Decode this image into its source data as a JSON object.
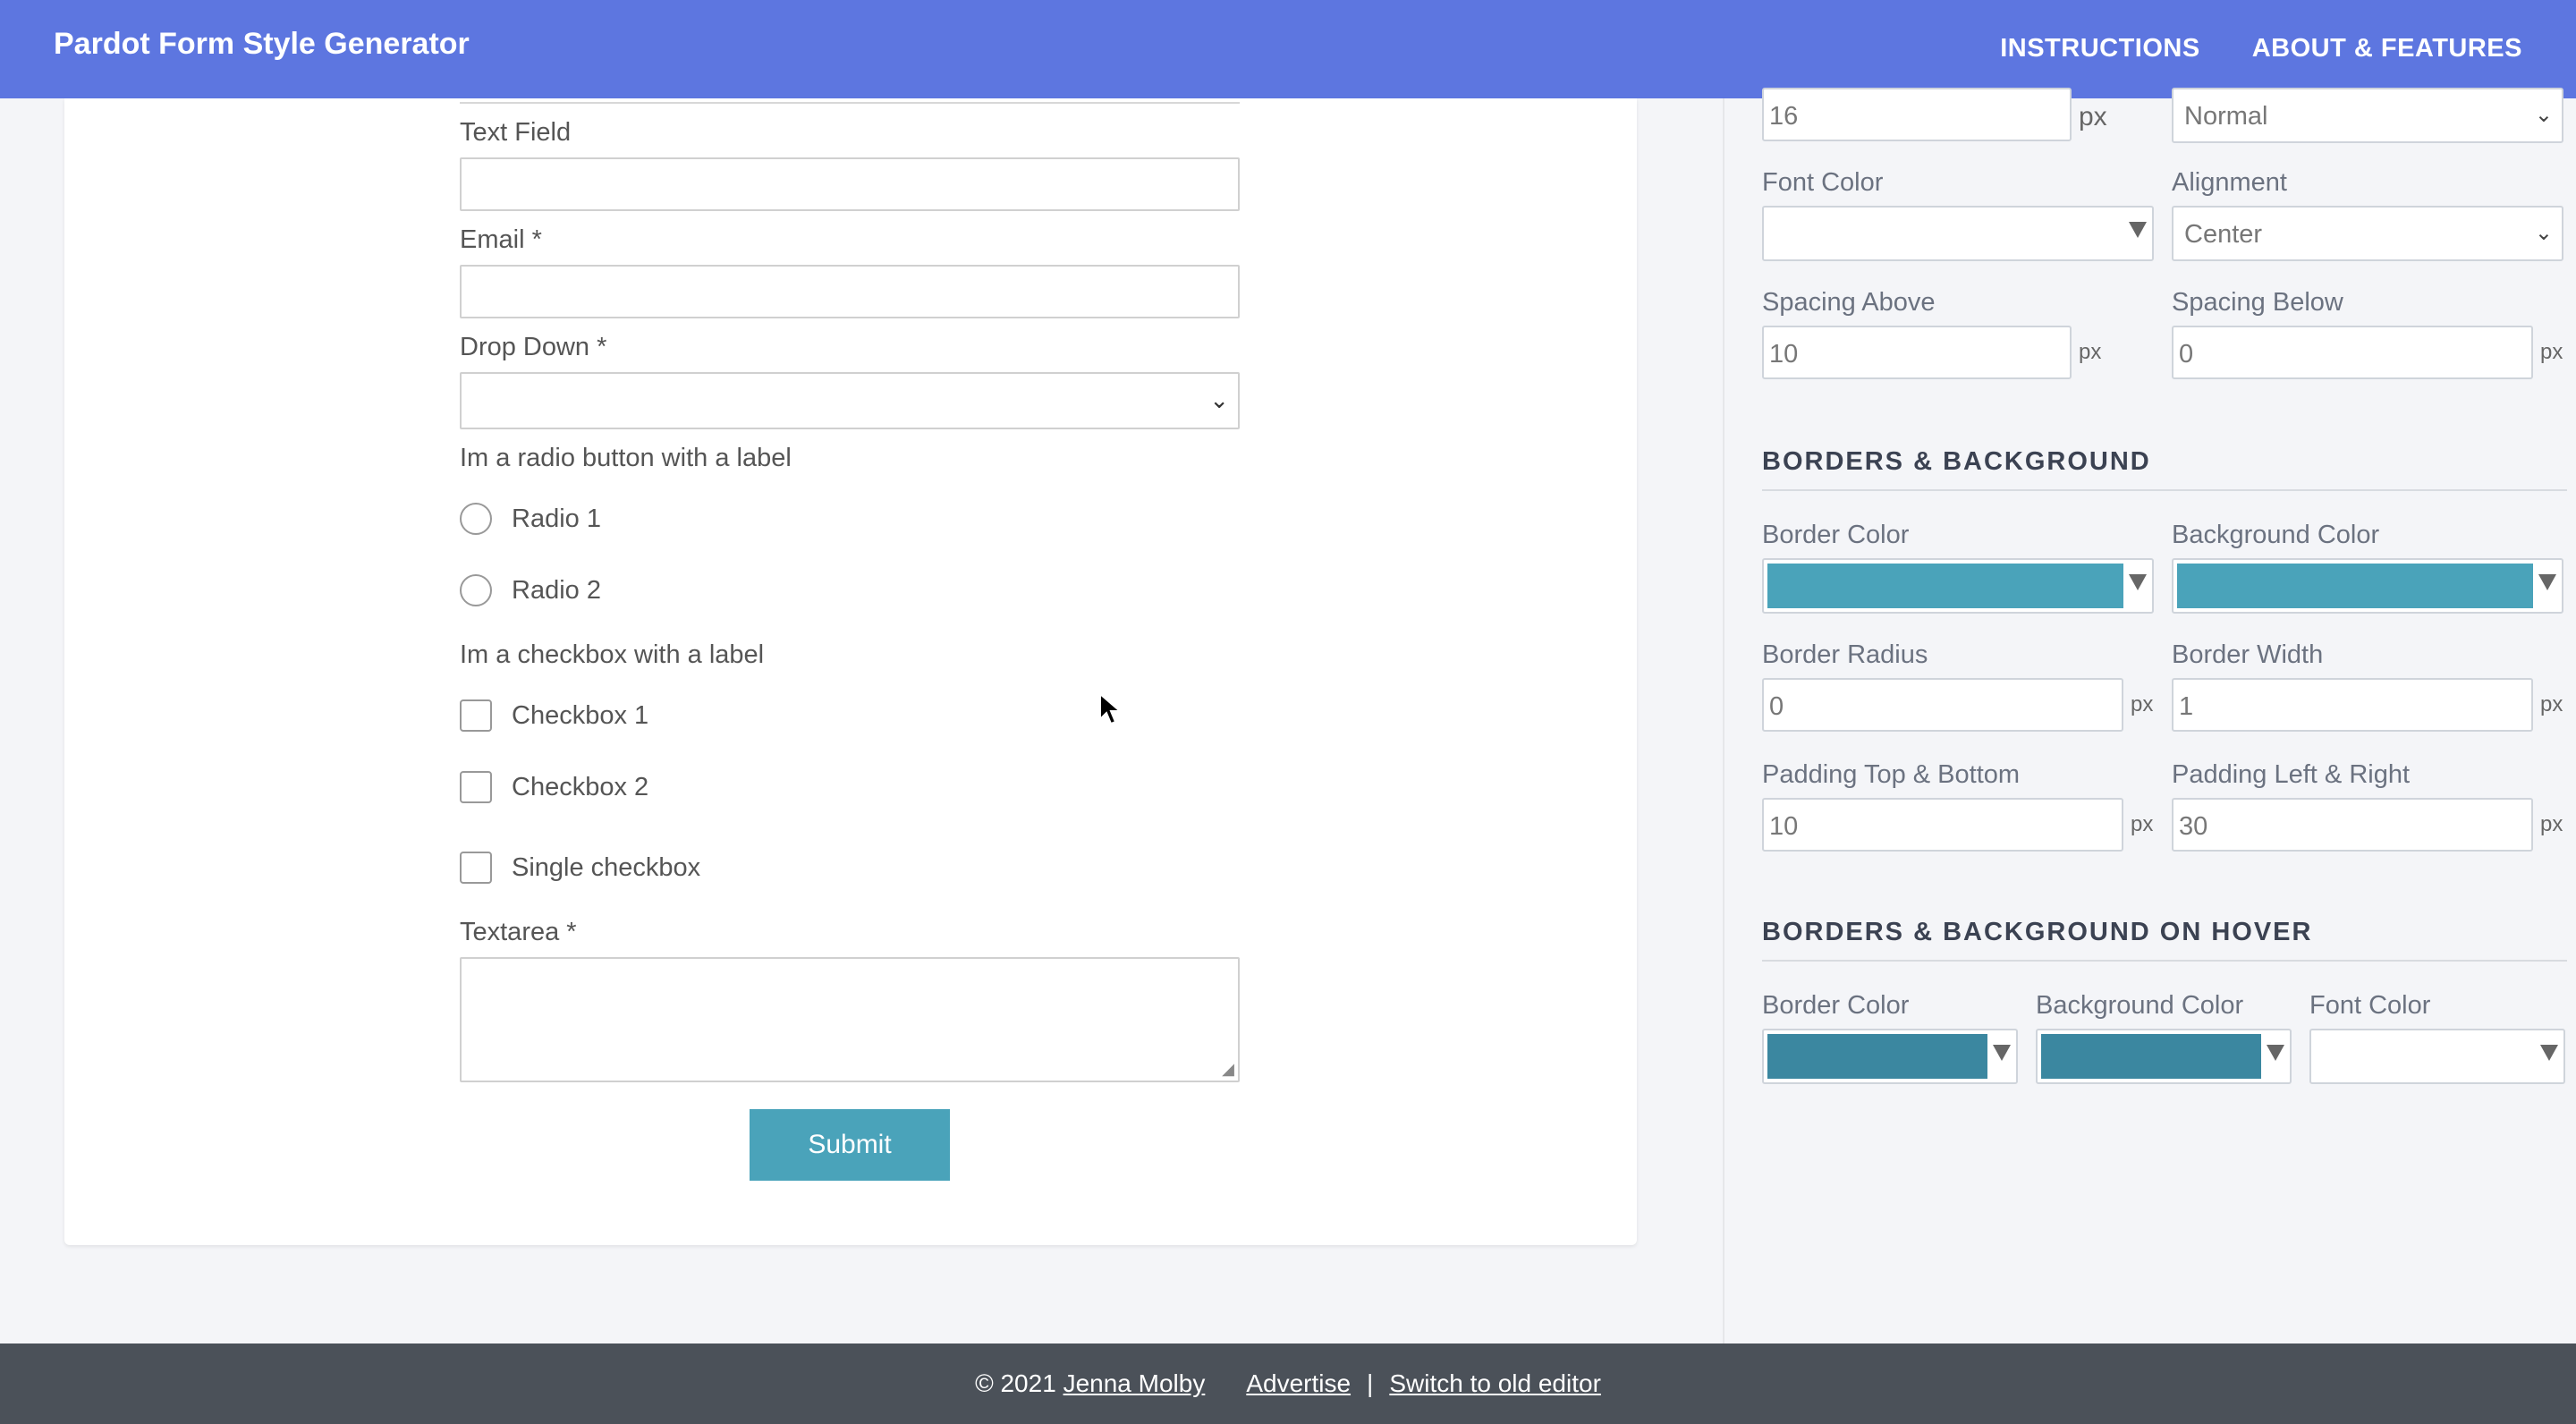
{
  "header": {
    "title": "Pardot Form Style Generator",
    "nav": [
      "INSTRUCTIONS",
      "ABOUT & FEATURES"
    ]
  },
  "form": {
    "text_field_label": "Text Field",
    "email_label": "Email *",
    "dropdown_label": "Drop Down *",
    "radio_group_label": "Im a radio button with a label",
    "radios": [
      "Radio 1",
      "Radio 2"
    ],
    "checkbox_group_label": "Im a checkbox with a label",
    "checkboxes": [
      "Checkbox 1",
      "Checkbox 2"
    ],
    "single_checkbox_label": "Single checkbox",
    "textarea_label": "Textarea *",
    "submit_label": "Submit"
  },
  "panel": {
    "font_size_value": "16",
    "font_size_unit": "px",
    "font_weight_value": "Normal",
    "font_color_label": "Font Color",
    "alignment_label": "Alignment",
    "alignment_value": "Center",
    "spacing_above_label": "Spacing Above",
    "spacing_above_value": "10",
    "spacing_below_label": "Spacing Below",
    "spacing_below_value": "0",
    "unit": "px",
    "borders_bg_title": "BORDERS & BACKGROUND",
    "border_color_label": "Border Color",
    "border_color_value": "#4aa3ba",
    "background_color_label": "Background Color",
    "background_color_value": "#4aa3ba",
    "border_radius_label": "Border Radius",
    "border_radius_value": "0",
    "border_width_label": "Border Width",
    "border_width_value": "1",
    "padding_tb_label": "Padding Top & Bottom",
    "padding_tb_value": "10",
    "padding_lr_label": "Padding Left & Right",
    "padding_lr_value": "30",
    "hover_title": "BORDERS & BACKGROUND ON HOVER",
    "hover_border_color_label": "Border Color",
    "hover_border_color_value": "#3b87a0",
    "hover_background_color_label": "Background Color",
    "hover_background_color_value": "#3b87a0",
    "hover_font_color_label": "Font Color"
  },
  "footer": {
    "copyright": "© 2021",
    "author": "Jenna Molby",
    "advertise": "Advertise",
    "separator": "|",
    "old_editor": "Switch to old editor"
  }
}
